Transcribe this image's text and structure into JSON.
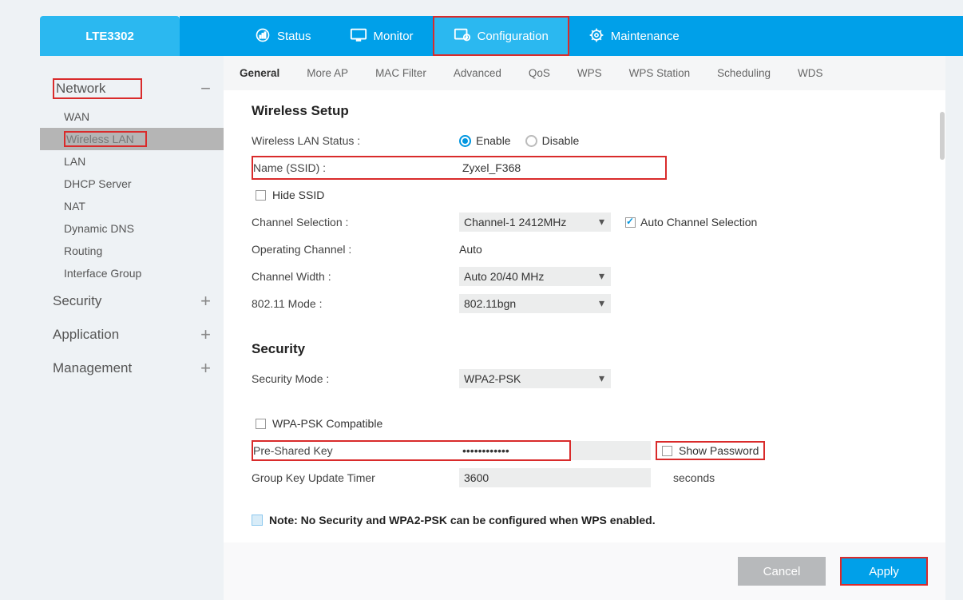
{
  "brand": "LTE3302",
  "topnav": [
    {
      "label": "Status",
      "active": false
    },
    {
      "label": "Monitor",
      "active": false
    },
    {
      "label": "Configuration",
      "active": true
    },
    {
      "label": "Maintenance",
      "active": false
    }
  ],
  "sidebar": {
    "groups": [
      {
        "title": "Network",
        "open": true,
        "items": [
          "WAN",
          "Wireless LAN",
          "LAN",
          "DHCP Server",
          "NAT",
          "Dynamic DNS",
          "Routing",
          "Interface Group"
        ],
        "selected": "Wireless LAN"
      },
      {
        "title": "Security",
        "open": false,
        "items": []
      },
      {
        "title": "Application",
        "open": false,
        "items": []
      },
      {
        "title": "Management",
        "open": false,
        "items": []
      }
    ]
  },
  "subtabs": [
    "General",
    "More AP",
    "MAC Filter",
    "Advanced",
    "QoS",
    "WPS",
    "WPS Station",
    "Scheduling",
    "WDS"
  ],
  "subtab_active": "General",
  "wireless": {
    "section_title": "Wireless Setup",
    "status_label": "Wireless LAN Status :",
    "enable_label": "Enable",
    "disable_label": "Disable",
    "status_value": "Enable",
    "name_label": "Name (SSID) :",
    "name_value": "Zyxel_F368",
    "hide_ssid_label": "Hide SSID",
    "hide_ssid_checked": false,
    "channel_sel_label": "Channel Selection :",
    "channel_sel_value": "Channel-1 2412MHz",
    "auto_channel_label": "Auto Channel Selection",
    "auto_channel_checked": true,
    "op_channel_label": "Operating Channel :",
    "op_channel_value": "Auto",
    "channel_width_label": "Channel Width :",
    "channel_width_value": "Auto 20/40 MHz",
    "mode_label": "802.11 Mode :",
    "mode_value": "802.11bgn"
  },
  "security": {
    "section_title": "Security",
    "mode_label": "Security Mode :",
    "mode_value": "WPA2-PSK",
    "wpa_compat_label": "WPA-PSK Compatible",
    "wpa_compat_checked": false,
    "psk_label": "Pre-Shared Key",
    "psk_value": "••••••••••••",
    "show_pw_label": "Show Password",
    "show_pw_checked": false,
    "gku_label": "Group Key Update Timer",
    "gku_value": "3600",
    "gku_unit": "seconds"
  },
  "note": "Note: No Security and WPA2-PSK can be configured when WPS enabled.",
  "buttons": {
    "cancel": "Cancel",
    "apply": "Apply"
  }
}
